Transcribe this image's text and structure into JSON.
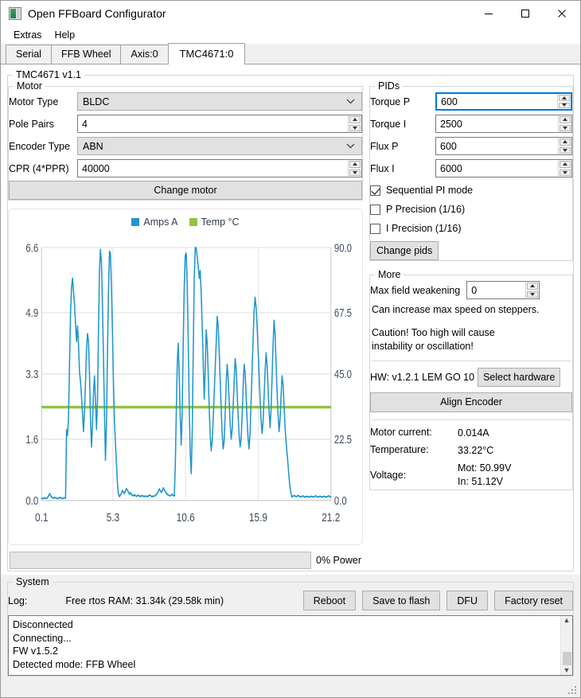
{
  "window": {
    "title": "Open FFBoard Configurator",
    "icon": "app-image-icon",
    "controls": {
      "minimize": "minimize-icon",
      "maximize": "maximize-icon",
      "close": "close-icon"
    }
  },
  "menu": {
    "items": [
      "Extras",
      "Help"
    ]
  },
  "tabs": {
    "items": [
      "Serial",
      "FFB Wheel",
      "Axis:0",
      "TMC4671:0"
    ],
    "selected_index": 3
  },
  "outer_group": {
    "legend": "TMC4671 v1.1"
  },
  "motor": {
    "legend": "Motor",
    "motor_type_label": "Motor Type",
    "motor_type_value": "BLDC",
    "pole_pairs_label": "Pole Pairs",
    "pole_pairs_value": "4",
    "encoder_type_label": "Encoder Type",
    "encoder_type_value": "ABN",
    "cpr_label": "CPR (4*PPR)",
    "cpr_value": "40000",
    "change_motor_label": "Change motor"
  },
  "pids": {
    "legend": "PIDs",
    "torque_p_label": "Torque P",
    "torque_p_value": "600",
    "torque_i_label": "Torque I",
    "torque_i_value": "2500",
    "flux_p_label": "Flux P",
    "flux_p_value": "600",
    "flux_i_label": "Flux I",
    "flux_i_value": "6000",
    "sequential_label": "Sequential PI mode",
    "sequential_checked": true,
    "p_precision_label": "P Precision (1/16)",
    "p_precision_checked": false,
    "i_precision_label": "I Precision (1/16)",
    "i_precision_checked": false,
    "change_pids_label": "Change pids"
  },
  "more": {
    "legend": "More",
    "max_field_weakening_label": "Max field weakening",
    "max_field_weakening_value": "0",
    "help_line1": "Can increase max speed on steppers.",
    "help_line2": "Caution! Too high will cause",
    "help_line3": "instability or oscillation!",
    "hw_label": "HW: v1.2.1 LEM GO 10",
    "select_hardware_label": "Select hardware",
    "align_encoder_label": "Align Encoder",
    "motor_current_label": "Motor current:",
    "motor_current_value": "0.014A",
    "temperature_label": "Temperature:",
    "temperature_value": "33.22°C",
    "voltage_label": "Voltage:",
    "voltage_value_mot": "Mot: 50.99V",
    "voltage_value_in": "In: 51.12V"
  },
  "power": {
    "percent": 0,
    "label": "0% Power"
  },
  "system": {
    "legend": "System",
    "log_label": "Log:",
    "ram_text": "Free rtos RAM:  31.34k (29.58k min)",
    "buttons": [
      "Reboot",
      "Save to flash",
      "DFU",
      "Factory reset"
    ],
    "log_lines": [
      "Disconnected",
      "Connecting...",
      "FW v1.5.2",
      "Detected mode: FFB Wheel"
    ]
  },
  "chart_data": {
    "type": "line",
    "title": "",
    "xlabel": "",
    "ylabel": "",
    "grid": true,
    "legend_position": "top-center",
    "colors": {
      "amps": "#2196cd",
      "temp": "#8fc440"
    },
    "legend": [
      "Amps A",
      "Temp °C"
    ],
    "x_ticks": [
      "0.1",
      "5.3",
      "10.6",
      "15.9",
      "21.2"
    ],
    "x_tick_values": [
      0.1,
      5.3,
      10.6,
      15.9,
      21.2
    ],
    "xlim": [
      0.1,
      21.2
    ],
    "y_left_ticks": [
      "0.0",
      "1.6",
      "3.3",
      "4.9",
      "6.6"
    ],
    "y_left_tick_values": [
      0.0,
      1.6,
      3.3,
      4.9,
      6.6
    ],
    "ylim_left": [
      0.0,
      6.6
    ],
    "y_right_ticks": [
      "0.0",
      "22.5",
      "45.0",
      "67.5",
      "90.0"
    ],
    "y_right_tick_values": [
      0.0,
      22.5,
      45.0,
      67.5,
      90.0
    ],
    "ylim_right": [
      0.0,
      90.0
    ],
    "series": [
      {
        "name": "Amps A",
        "axis": "left",
        "color": "#2196cd",
        "values": [
          0.05,
          0.06,
          0.05,
          0.07,
          0.06,
          0.05,
          0.08,
          0.12,
          0.18,
          0.13,
          0.09,
          0.07,
          0.06,
          0.08,
          0.07,
          0.06,
          0.05,
          0.06,
          0.08,
          0.07,
          0.06,
          0.05,
          0.06,
          0.07,
          0.06,
          1.85,
          1.7,
          2.2,
          3.6,
          4.9,
          5.55,
          5.8,
          5.45,
          5.1,
          4.6,
          4.15,
          4.55,
          4.05,
          3.35,
          3.1,
          2.7,
          2.25,
          1.8,
          2.35,
          3.1,
          3.95,
          4.35,
          4.15,
          3.3,
          2.15,
          1.4,
          1.95,
          2.8,
          3.25,
          2.6,
          1.85,
          2.6,
          4.4,
          6.0,
          6.55,
          6.2,
          5.1,
          3.7,
          2.3,
          1.05,
          2.0,
          3.8,
          5.4,
          6.5,
          6.45,
          5.6,
          4.4,
          3.1,
          2.05,
          1.5,
          1.0,
          0.45,
          0.18,
          0.1,
          0.14,
          0.19,
          0.26,
          0.22,
          0.18,
          0.25,
          0.31,
          0.27,
          0.22,
          0.17,
          0.2,
          0.16,
          0.14,
          0.12,
          0.15,
          0.13,
          0.11,
          0.12,
          0.14,
          0.12,
          0.1,
          0.12,
          0.13,
          0.11,
          0.1,
          0.12,
          0.11,
          0.1,
          0.12,
          0.14,
          0.13,
          0.11,
          0.1,
          0.12,
          0.11,
          0.13,
          0.16,
          0.19,
          0.24,
          0.3,
          0.26,
          0.21,
          0.25,
          0.33,
          0.28,
          0.23,
          0.19,
          0.16,
          0.14,
          0.13,
          0.12,
          0.14,
          0.16,
          0.13,
          0.12,
          0.9,
          2.3,
          3.6,
          4.1,
          3.2,
          2.15,
          1.45,
          2.4,
          4.2,
          5.6,
          6.4,
          6.45,
          5.6,
          4.1,
          2.4,
          1.2,
          0.7,
          1.8,
          3.9,
          5.8,
          6.6,
          6.58,
          6.35,
          6.1,
          5.8,
          6.0,
          5.4,
          4.55,
          3.6,
          2.65,
          3.4,
          4.45,
          4.1,
          3.3,
          2.4,
          1.7,
          1.3,
          1.55,
          2.1,
          2.8,
          3.45,
          4.1,
          4.8,
          4.55,
          3.9,
          3.15,
          2.4,
          1.75,
          1.35,
          1.55,
          2.25,
          3.05,
          3.55,
          3.2,
          2.6,
          2.0,
          1.6,
          1.85,
          2.45,
          3.1,
          3.7,
          3.45,
          2.85,
          2.2,
          1.7,
          1.4,
          1.6,
          2.2,
          2.95,
          3.55,
          3.35,
          2.75,
          2.1,
          1.6,
          1.35,
          1.8,
          2.6,
          3.4,
          4.2,
          4.95,
          5.3,
          5.05,
          4.55,
          3.95,
          3.3,
          2.65,
          2.1,
          1.75,
          2.05,
          2.7,
          3.35,
          3.85,
          3.55,
          2.95,
          2.35,
          1.9,
          2.35,
          3.2,
          4.05,
          4.7,
          4.35,
          3.6,
          2.85,
          2.25,
          1.8,
          2.1,
          2.7,
          3.25,
          3.05,
          2.5,
          1.95,
          1.55,
          1.25,
          0.95,
          0.62,
          0.35,
          0.18,
          0.09,
          0.11,
          0.13,
          0.12,
          0.1,
          0.11,
          0.13,
          0.12,
          0.1,
          0.09,
          0.11,
          0.12,
          0.1,
          0.09,
          0.1,
          0.11,
          0.1,
          0.09,
          0.1,
          0.11,
          0.1,
          0.09,
          0.1,
          0.11,
          0.12,
          0.1,
          0.09,
          0.1,
          0.11,
          0.1,
          0.09,
          0.1,
          0.11,
          0.1,
          0.09,
          0.1,
          0.11,
          0.12,
          0.1,
          0.09
        ]
      },
      {
        "name": "Temp °C",
        "axis": "right",
        "color": "#8fc440",
        "constant_value": 33.2
      }
    ]
  }
}
